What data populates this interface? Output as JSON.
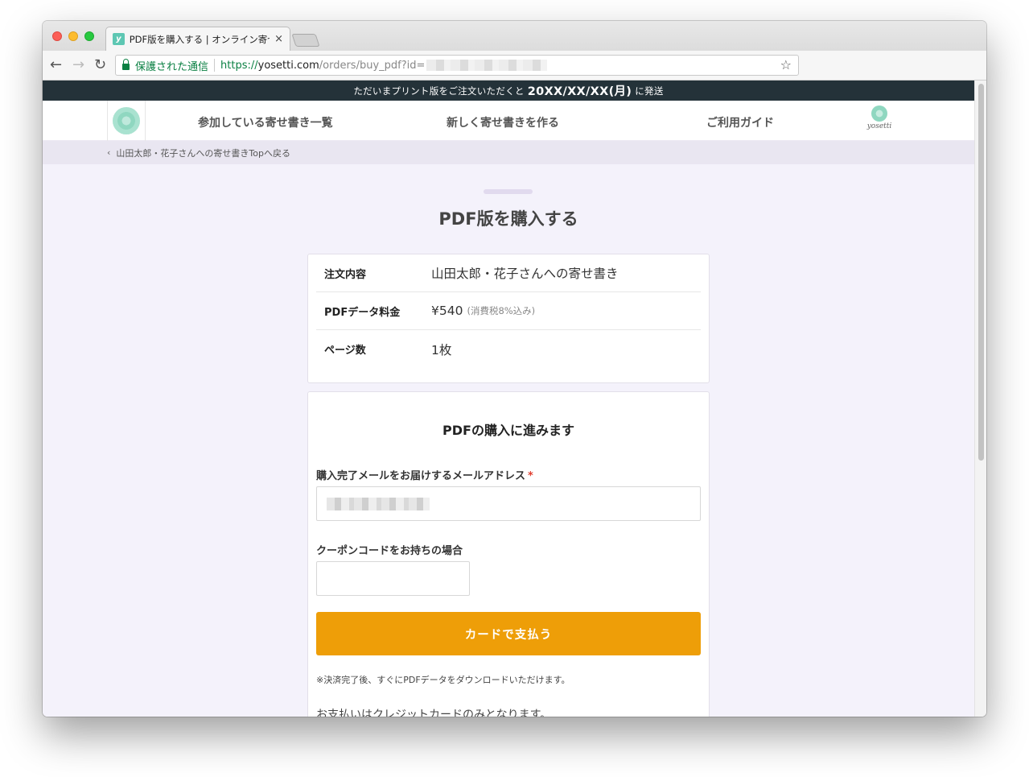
{
  "browser": {
    "tab_title": "PDF版を購入する | オンライン寄せ",
    "tab_close": "×",
    "secure_label": "保護された通信",
    "url_scheme": "https://",
    "url_host": "yosetti.com",
    "url_path": "/orders/buy_pdf?id=",
    "nav_back": "←",
    "nav_forward": "→",
    "nav_reload": "↻",
    "star": "☆",
    "favicon": "y"
  },
  "announcement": {
    "prefix": "ただいまプリント版をご注文いただくと",
    "date": "20XX/XX/XX(月)",
    "suffix": "に発送"
  },
  "header": {
    "nav_items": [
      "参加している寄せ書き一覧",
      "新しく寄せ書きを作る",
      "ご利用ガイド"
    ],
    "brand_name": "yosetti"
  },
  "breadcrumb": {
    "chevron": "‹",
    "text": "山田太郎・花子さんへの寄せ書きTopへ戻る"
  },
  "page": {
    "title": "PDF版を購入する"
  },
  "order": {
    "rows": [
      {
        "label": "注文内容",
        "value": "山田太郎・花子さんへの寄せ書き",
        "note": ""
      },
      {
        "label": "PDFデータ料金",
        "value": "¥540",
        "note": "(消費税8%込み)"
      },
      {
        "label": "ページ数",
        "value": "1枚",
        "note": ""
      }
    ]
  },
  "form": {
    "heading": "PDFの購入に進みます",
    "email_label": "購入完了メールをお届けするメールアドレス",
    "required_mark": "*",
    "coupon_label": "クーポンコードをお持ちの場合",
    "pay_button": "カードで支払う",
    "note_small": "※決済完了後、すぐにPDFデータをダウンロードいただけます。",
    "note_large": "お支払いはクレジットカードのみとなります。"
  }
}
